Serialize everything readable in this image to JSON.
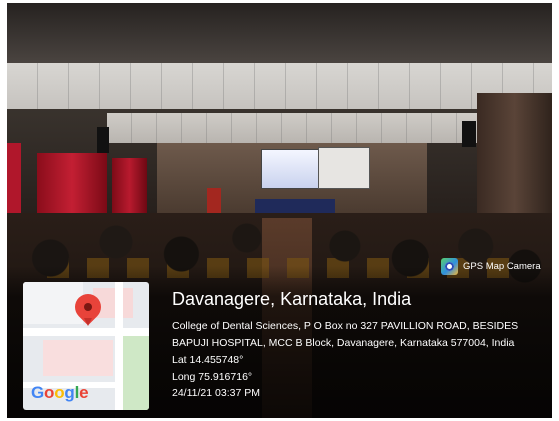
{
  "stamp": {
    "app_name": "GPS Map Camera",
    "location_title": "Davanagere, Karnataka, India",
    "address_line1": "College of Dental Sciences, P O Box no 327 PAVILLION ROAD, BESIDES",
    "address_line2": "BAPUJI HOSPITAL, MCC B Block, Davanagere, Karnataka 577004, India",
    "latitude": "Lat 14.455748°",
    "longitude": "Long 75.916716°",
    "datetime": "24/11/21 03:37 PM"
  },
  "map": {
    "logo_text": {
      "g1": "G",
      "o1": "o",
      "o2": "o",
      "g2": "g",
      "l": "l",
      "e": "e"
    },
    "pin_color": "#e8433a"
  },
  "icons": [
    "map-pin-icon",
    "gps-map-camera-icon"
  ]
}
